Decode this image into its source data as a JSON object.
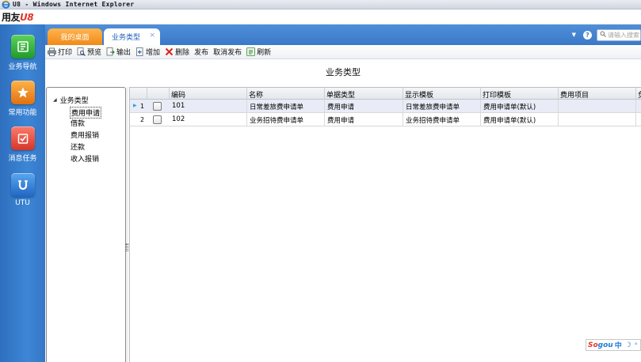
{
  "window": {
    "title": "U8 - Windows Internet Explorer",
    "brand_text": "用友",
    "brand_suffix": "U8"
  },
  "left_nav": [
    {
      "label": "业务导航",
      "icon": "business-nav-icon",
      "color": "#2fb53a"
    },
    {
      "label": "常用功能",
      "icon": "star-icon",
      "color": "#f08a18"
    },
    {
      "label": "消息任务",
      "icon": "message-task-icon",
      "color": "#e04a3a"
    },
    {
      "label": "UTU",
      "icon": "utu-icon",
      "color": "#2a7ad6"
    }
  ],
  "tabs": [
    {
      "label": "我的桌面",
      "active": false
    },
    {
      "label": "业务类型",
      "active": true,
      "close": "×"
    }
  ],
  "header_right": {
    "dropdown_glyph": "▼",
    "help_glyph": "?",
    "search_placeholder": "请输入搜索"
  },
  "toolbar": [
    {
      "label": "打印",
      "icon": "print-icon"
    },
    {
      "label": "预览",
      "icon": "preview-icon"
    },
    {
      "label": "输出",
      "icon": "export-icon"
    },
    {
      "label": "增加",
      "icon": "add-icon"
    },
    {
      "label": "删除",
      "icon": "delete-icon"
    },
    {
      "label": "发布",
      "icon": ""
    },
    {
      "label": "取消发布",
      "icon": ""
    },
    {
      "label": "刷新",
      "icon": "refresh-icon"
    }
  ],
  "page_title": "业务类型",
  "tree": {
    "root": "业务类型",
    "children": [
      {
        "label": "费用申请",
        "selected": true
      },
      {
        "label": "借款",
        "selected": false
      },
      {
        "label": "费用报销",
        "selected": false
      },
      {
        "label": "还款",
        "selected": false
      },
      {
        "label": "收入报销",
        "selected": false
      }
    ]
  },
  "grid": {
    "columns": [
      "编码",
      "名称",
      "单据类型",
      "显示模板",
      "打印模板",
      "费用项目",
      "负"
    ],
    "rows": [
      {
        "num": "1",
        "cells": [
          "101",
          "日常差旅费申请单",
          "费用申请",
          "日常差旅费申请单",
          "费用申请单(默认)",
          ""
        ],
        "selected": true
      },
      {
        "num": "2",
        "cells": [
          "102",
          "业务招待费申请单",
          "费用申请",
          "业务招待费申请单",
          "费用申请单(默认)",
          ""
        ],
        "selected": false
      }
    ]
  },
  "ime": {
    "s1": "So",
    "s2": "gou",
    "zh": "中",
    "moon": "☽",
    "dot": "°"
  }
}
